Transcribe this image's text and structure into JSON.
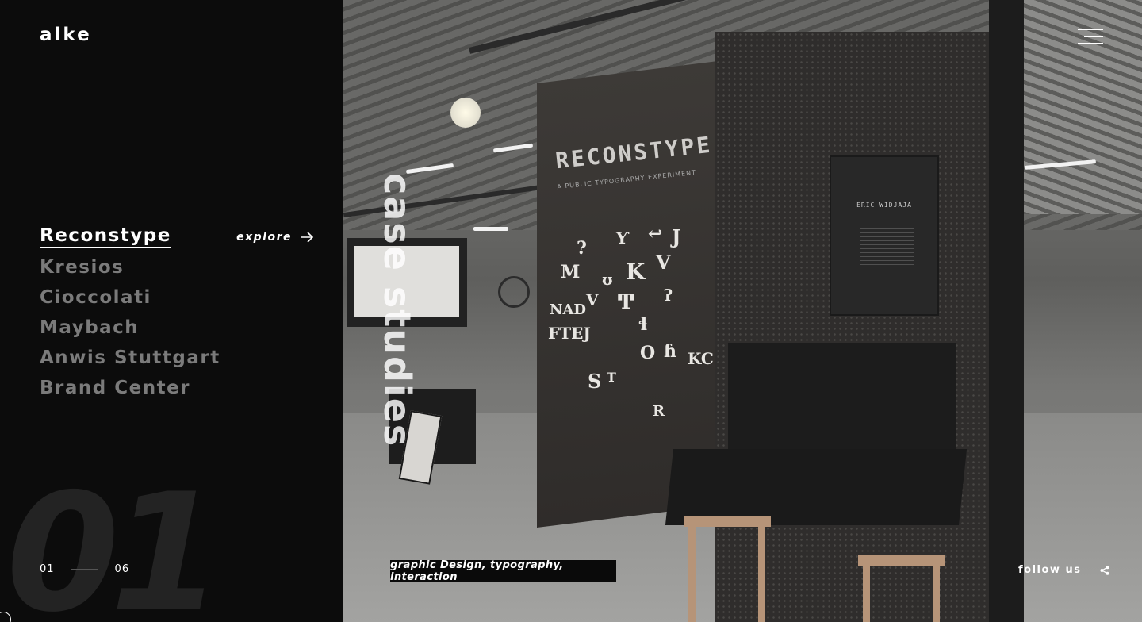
{
  "brand": {
    "logo": "alke"
  },
  "projects": [
    {
      "label": "Reconstype",
      "active": true
    },
    {
      "label": "Kresios",
      "active": false
    },
    {
      "label": "Cioccolati",
      "active": false
    },
    {
      "label": "Maybach",
      "active": false
    },
    {
      "label": "Anwis Stuttgart",
      "active": false
    },
    {
      "label": "Brand Center",
      "active": false
    }
  ],
  "explore": {
    "label": "explore",
    "icon": "arrow-right-icon"
  },
  "current_index_display": "01",
  "pager": {
    "current": "01",
    "total": "06"
  },
  "section_label": "case studies",
  "hero": {
    "sign_title": "RECONSTYPE",
    "sign_subtitle": "A PUBLIC TYPOGRAPHY EXPERIMENT",
    "placard_name": "ERIC WIDJAJA"
  },
  "tags": "graphic Design, typography, interaction",
  "follow": {
    "label": "follow us",
    "icon": "share-icon"
  },
  "menu_icon": "hamburger-menu-icon",
  "colors": {
    "background": "#0c0c0c",
    "active_text": "#ffffff",
    "inactive_text": "#7b7b7b",
    "big_number": "#232323"
  }
}
